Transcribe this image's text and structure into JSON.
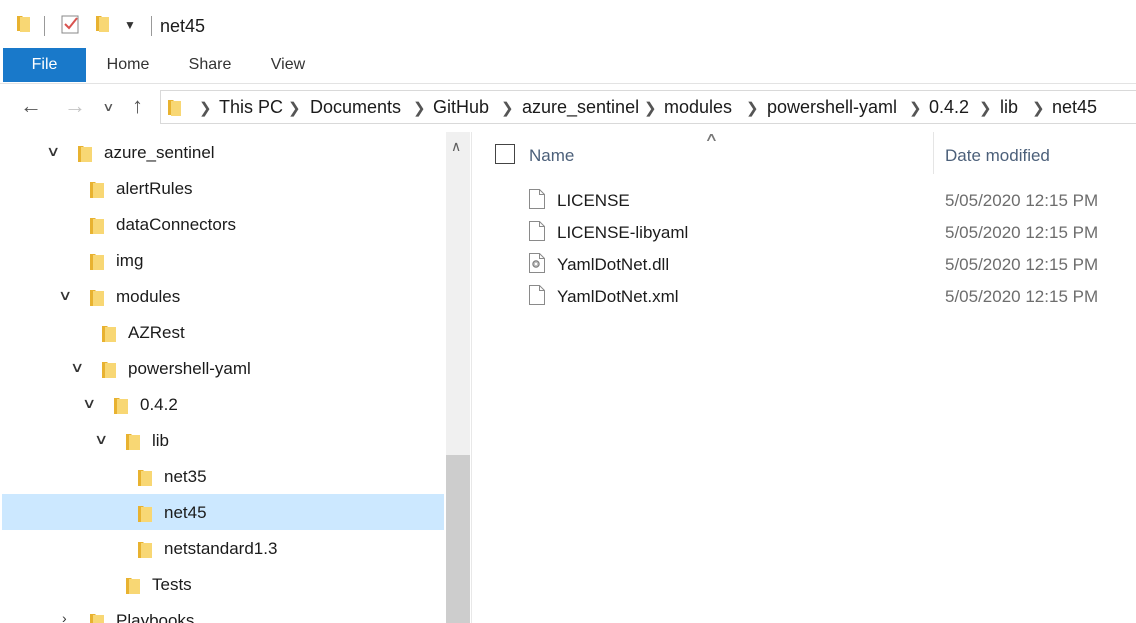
{
  "window": {
    "title": "net45"
  },
  "ribbon": {
    "tabs": [
      "File",
      "Home",
      "Share",
      "View"
    ]
  },
  "breadcrumb": [
    "This PC",
    "Documents",
    "GitHub",
    "azure_sentinel",
    "modules",
    "powershell-yaml",
    "0.4.2",
    "lib",
    "net45"
  ],
  "tree": {
    "items": [
      {
        "label": "azure_sentinel",
        "expanded": true
      },
      {
        "label": "alertRules"
      },
      {
        "label": "dataConnectors"
      },
      {
        "label": "img"
      },
      {
        "label": "modules",
        "expanded": true
      },
      {
        "label": "AZRest"
      },
      {
        "label": "powershell-yaml",
        "expanded": true
      },
      {
        "label": "0.4.2",
        "expanded": true
      },
      {
        "label": "lib",
        "expanded": true
      },
      {
        "label": "net35"
      },
      {
        "label": "net45",
        "selected": true
      },
      {
        "label": "netstandard1.3"
      },
      {
        "label": "Tests"
      },
      {
        "label": "Playbooks",
        "expanded": false
      }
    ]
  },
  "files": {
    "columns": {
      "name": "Name",
      "date": "Date modified"
    },
    "rows": [
      {
        "name": "LICENSE",
        "date": "5/05/2020 12:15 PM",
        "icon": "file-icon"
      },
      {
        "name": "LICENSE-libyaml",
        "date": "5/05/2020 12:15 PM",
        "icon": "file-icon"
      },
      {
        "name": "YamlDotNet.dll",
        "date": "5/05/2020 12:15 PM",
        "icon": "dll-file-icon"
      },
      {
        "name": "YamlDotNet.xml",
        "date": "5/05/2020 12:15 PM",
        "icon": "file-icon"
      }
    ]
  },
  "colors": {
    "accent": "#1979ca",
    "selection": "#cce8ff",
    "folder": "#f6d26a",
    "header_text": "#4c607a"
  }
}
